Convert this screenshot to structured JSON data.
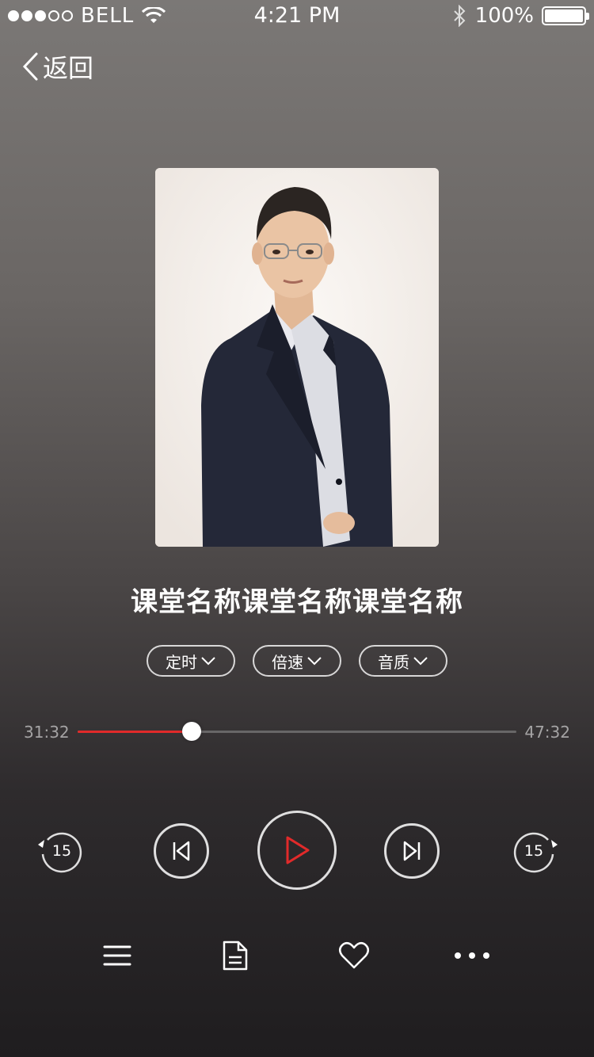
{
  "status_bar": {
    "carrier": "BELL",
    "time": "4:21 PM",
    "battery": "100%"
  },
  "nav": {
    "back_label": "返回"
  },
  "course": {
    "title": "课堂名称课堂名称课堂名称"
  },
  "options": [
    {
      "label": "定时"
    },
    {
      "label": "倍速"
    },
    {
      "label": "音质"
    }
  ],
  "player": {
    "current_time": "31:32",
    "total_time": "47:32",
    "progress": 0.26,
    "rewind_seconds": "15",
    "forward_seconds": "15"
  },
  "colors": {
    "accent": "#e12a2a"
  },
  "icons": {
    "bottom": [
      "playlist-icon",
      "document-icon",
      "heart-icon",
      "more-icon"
    ]
  }
}
